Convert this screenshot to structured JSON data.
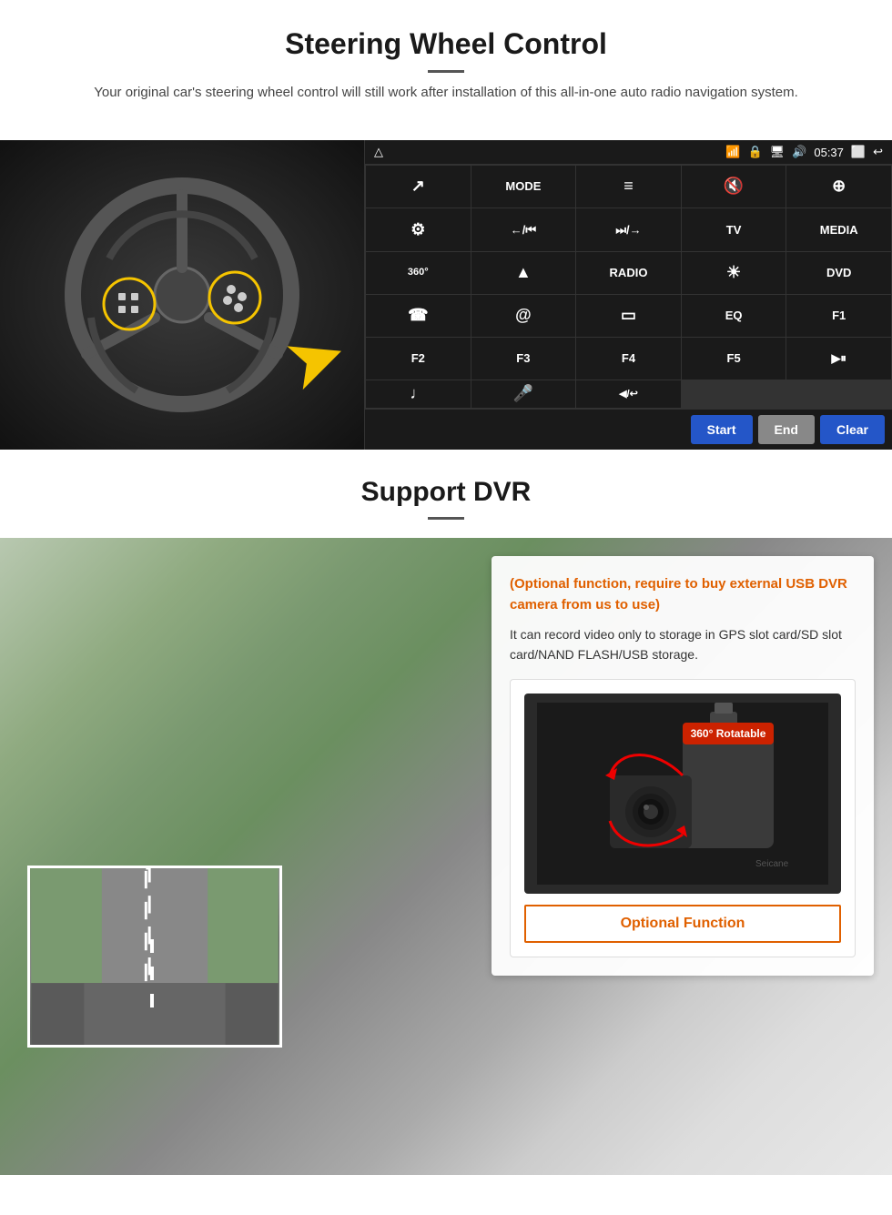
{
  "page": {
    "section1": {
      "title": "Steering Wheel Control",
      "description": "Your original car's steering wheel control will still work after installation of this all-in-one auto radio navigation system.",
      "ui_buttons": [
        {
          "label": "↗",
          "row": 1,
          "col": 1
        },
        {
          "label": "MODE",
          "row": 1,
          "col": 2
        },
        {
          "label": "≡",
          "row": 1,
          "col": 3
        },
        {
          "label": "🔇",
          "row": 1,
          "col": 4
        },
        {
          "label": "⊕",
          "row": 1,
          "col": 5
        },
        {
          "label": "⚙",
          "row": 2,
          "col": 1
        },
        {
          "label": "←/⏮",
          "row": 2,
          "col": 2
        },
        {
          "label": "⏭/→",
          "row": 2,
          "col": 3
        },
        {
          "label": "TV",
          "row": 2,
          "col": 4
        },
        {
          "label": "MEDIA",
          "row": 2,
          "col": 5
        },
        {
          "label": "360°",
          "row": 3,
          "col": 1
        },
        {
          "label": "▲",
          "row": 3,
          "col": 2
        },
        {
          "label": "RADIO",
          "row": 3,
          "col": 3
        },
        {
          "label": "☀",
          "row": 3,
          "col": 4
        },
        {
          "label": "DVD",
          "row": 3,
          "col": 5
        },
        {
          "label": "☎",
          "row": 4,
          "col": 1
        },
        {
          "label": "@",
          "row": 4,
          "col": 2
        },
        {
          "label": "▭",
          "row": 4,
          "col": 3
        },
        {
          "label": "EQ",
          "row": 4,
          "col": 4
        },
        {
          "label": "F1",
          "row": 4,
          "col": 5
        },
        {
          "label": "F2",
          "row": 5,
          "col": 1
        },
        {
          "label": "F3",
          "row": 5,
          "col": 2
        },
        {
          "label": "F4",
          "row": 5,
          "col": 3
        },
        {
          "label": "F5",
          "row": 5,
          "col": 4
        },
        {
          "label": "▶⏸",
          "row": 5,
          "col": 5
        },
        {
          "label": "♩",
          "row": 6,
          "col": 1
        },
        {
          "label": "🎤",
          "row": 6,
          "col": 2
        },
        {
          "label": "◀/↩",
          "row": 6,
          "col": 3
        }
      ],
      "status_bar": {
        "home_icon": "△",
        "back_icon": "↩",
        "time": "05:37",
        "wifi_icon": "wifi",
        "battery_icon": "battery",
        "lock_icon": "lock",
        "volume_icon": "volume"
      },
      "bottom_controls": {
        "start_label": "Start",
        "end_label": "End",
        "clear_label": "Clear"
      }
    },
    "section2": {
      "title": "Support DVR",
      "optional_note": "(Optional function, require to buy external USB DVR camera from us to use)",
      "description": "It can record video only to storage in GPS slot card/SD slot card/NAND FLASH/USB storage.",
      "badge_label": "360° Rotatable",
      "optional_fn_label": "Optional Function",
      "brand": "Seicane"
    }
  }
}
